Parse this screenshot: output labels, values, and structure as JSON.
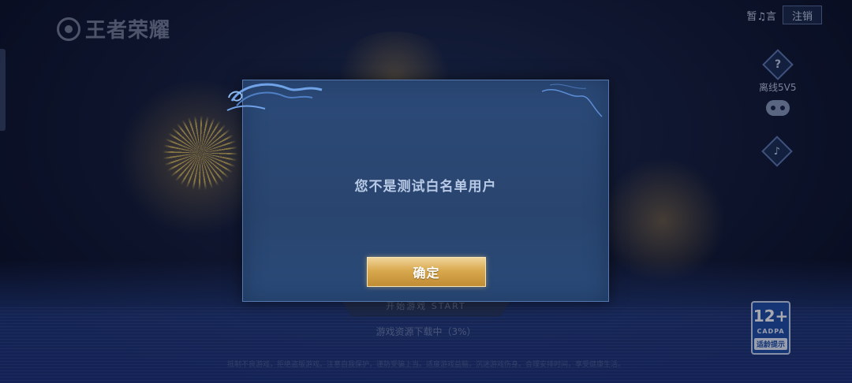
{
  "app": {
    "logo_text": "王者荣耀"
  },
  "top_bar": {
    "mute_label": "暂♫言",
    "logout_label": "注销"
  },
  "side_controls": {
    "help_icon": "?",
    "offline_label": "离线5V5",
    "gamepad_icon": "gamepad-icon",
    "speaker_icon": "speaker-icon"
  },
  "background": {
    "start_button_text": "开始游戏 START",
    "download_status": "游戏资源下载中（3%）",
    "footer_notice": "抵制不良游戏，拒绝盗版游戏。注意自我保护，谨防受骗上当。适度游戏益脑，沉迷游戏伤身。合理安排时间，享受健康生活。"
  },
  "age_rating": {
    "age": "12+",
    "org": "CADPA",
    "hint": "适龄提示"
  },
  "dialog": {
    "message": "您不是测试白名单用户",
    "confirm_label": "确定"
  },
  "colors": {
    "dialog_bg": "#2c4a78",
    "button_gold": "#d9a94f",
    "text_light": "#b9cae6",
    "badge_blue": "#1e4ea3"
  }
}
